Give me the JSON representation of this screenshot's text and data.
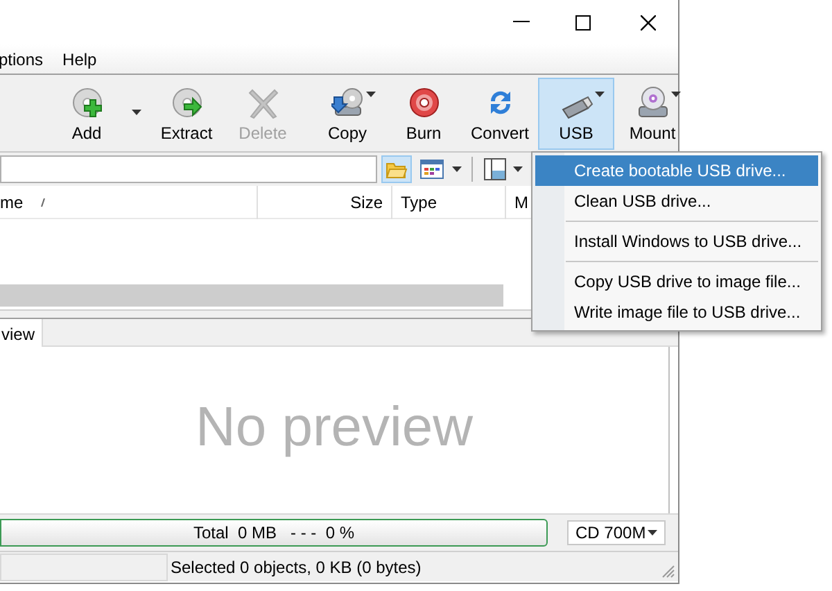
{
  "menu_bar": [
    "ptions",
    "Help"
  ],
  "toolbar": {
    "groups": [
      [
        {
          "kind": "add",
          "label": "Add",
          "dropdown": true,
          "disabled": false,
          "selected": false
        },
        {
          "kind": "extract",
          "label": "Extract",
          "dropdown": false,
          "disabled": false,
          "selected": false
        },
        {
          "kind": "delete",
          "label": "Delete",
          "dropdown": false,
          "disabled": true,
          "selected": false
        }
      ],
      [
        {
          "kind": "copy",
          "label": "Copy",
          "dropdown": true,
          "disabled": false,
          "selected": false
        },
        {
          "kind": "burn",
          "label": "Burn",
          "dropdown": false,
          "disabled": false,
          "selected": false
        },
        {
          "kind": "convert",
          "label": "Convert",
          "dropdown": false,
          "disabled": false,
          "selected": false
        },
        {
          "kind": "usb",
          "label": "USB",
          "dropdown": true,
          "disabled": false,
          "selected": true
        },
        {
          "kind": "mount",
          "label": "Mount",
          "dropdown": true,
          "disabled": false,
          "selected": false
        }
      ]
    ]
  },
  "file_list": {
    "columns": [
      "me",
      "Size",
      "Type",
      "M"
    ]
  },
  "tabs": [
    {
      "label": "view",
      "selected": true
    }
  ],
  "preview": {
    "message": "No preview"
  },
  "capacity_bar": {
    "text": "Total  0 MB   - - -  0 %",
    "level": 0,
    "disc_size": "CD 700M"
  },
  "status_bar": {
    "selection": "Selected 0 objects, 0 KB (0 bytes)"
  },
  "usb_menu": [
    {
      "label": "Create bootable USB drive...",
      "selected": true,
      "separator_before": false
    },
    {
      "label": "Clean USB drive...",
      "selected": false,
      "separator_before": false
    },
    {
      "label": "Install Windows to USB drive...",
      "selected": false,
      "separator_before": true
    },
    {
      "label": "Copy USB drive to image file...",
      "selected": false,
      "separator_before": true
    },
    {
      "label": "Write image file to USB drive...",
      "selected": false,
      "separator_before": false
    }
  ]
}
